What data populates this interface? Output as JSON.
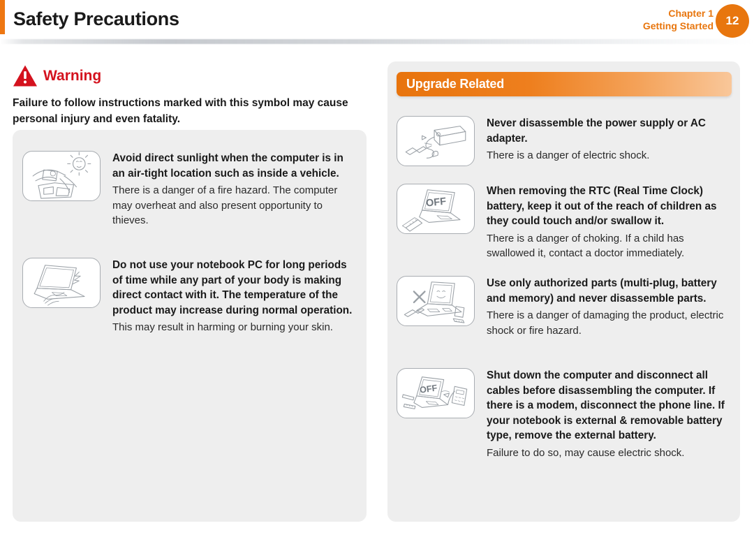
{
  "header": {
    "title": "Safety Precautions",
    "chapter": "Chapter 1",
    "section": "Getting Started",
    "page_number": "12",
    "accent_color": "#e8760e"
  },
  "warning": {
    "icon": "warning-triangle-icon",
    "label": "Warning",
    "label_color": "#d4121e",
    "description": "Failure to follow instructions marked with this symbol may cause personal injury and even fatality."
  },
  "left_panel": {
    "items": [
      {
        "icon": "car-dashboard-sunlight-icon",
        "title": "Avoid direct sunlight when the computer is in an air-tight location such as inside a vehicle.",
        "body": "There is a danger of a fire hazard. The computer may overheat and also present opportunity to thieves."
      },
      {
        "icon": "laptop-hot-hand-icon",
        "title": "Do not use your notebook PC for long periods of time while any part of your body is making direct contact with it. The temperature of the product may increase during normal operation.",
        "body": "This may result in harming or burning your skin."
      }
    ]
  },
  "right_panel": {
    "banner_title": "Upgrade Related",
    "banner_color": "#e8740d",
    "items": [
      {
        "icon": "ac-adapter-screwdriver-icon",
        "title": "Never disassemble the power supply or AC adapter.",
        "body": "There is a danger of electric shock."
      },
      {
        "icon": "laptop-off-rtc-battery-icon",
        "title": "When removing the RTC (Real Time Clock) battery, keep it out of the reach of children as they could touch and/or swallow it.",
        "body": "There is a danger of choking. If a child has swallowed it, contact a doctor immediately."
      },
      {
        "icon": "laptop-unauthorized-parts-x-icon",
        "title": "Use only authorized parts (multi-plug, battery and memory) and never disassemble parts.",
        "body": "There is a danger of damaging the product, electric shock or fire hazard."
      },
      {
        "icon": "laptop-off-phone-disconnect-icon",
        "title": "Shut down the computer and disconnect all cables before disassembling the computer. If there is a modem, disconnect the phone line. If your notebook is external & removable battery type, remove the external battery.",
        "body": "Failure to do so, may cause electric shock."
      }
    ]
  }
}
